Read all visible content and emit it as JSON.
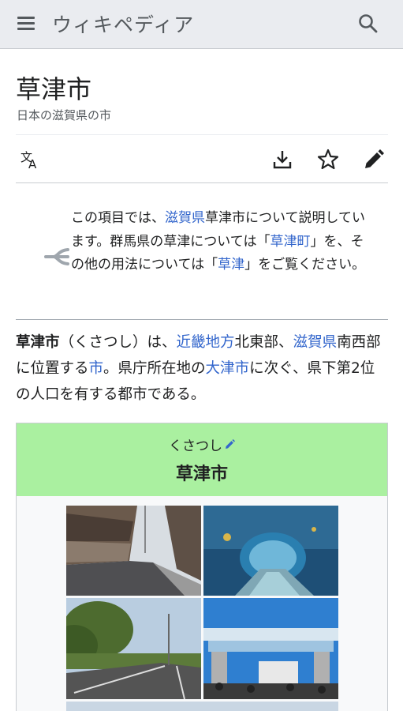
{
  "header": {
    "logo": "ウィキペディア",
    "menu_icon": "hamburger-menu-icon",
    "search_icon": "search-icon"
  },
  "article": {
    "title": "草津市",
    "subtitle": "日本の滋賀県の市"
  },
  "toolbar": {
    "language_icon": "language-icon",
    "download_icon": "download-icon",
    "watch_icon": "star-icon",
    "edit_icon": "pencil-icon"
  },
  "hatnote": {
    "p1": "この項目では、",
    "l1": "滋賀県",
    "p2": "草津市について説明しています。群馬県の草津については「",
    "l2": "草津町",
    "p3": "」を、その他の用法については「",
    "l3": "草津",
    "p4": "」をご覧ください。",
    "icon": "disambiguation-icon"
  },
  "lead": {
    "bold": "草津市",
    "p1": "（くさつし）は、",
    "l1": "近畿地方",
    "p2": "北東部、",
    "l2": "滋賀県",
    "p3": "南西部に位置する",
    "l3": "市",
    "p4": "。県庁所在地の",
    "l4": "大津市",
    "p5": "に次ぐ、県下第2位の人口を有する都市である。"
  },
  "infobox": {
    "kana": "くさつし",
    "name": "草津市",
    "header_color": "#aaf0a0",
    "photos": [
      "street-photo",
      "aquarium-tunnel-photo",
      "road-photo",
      "event-gate-photo"
    ]
  },
  "colors": {
    "link": "#3366cc",
    "header_bg": "#eaecf0",
    "text": "#202122"
  }
}
